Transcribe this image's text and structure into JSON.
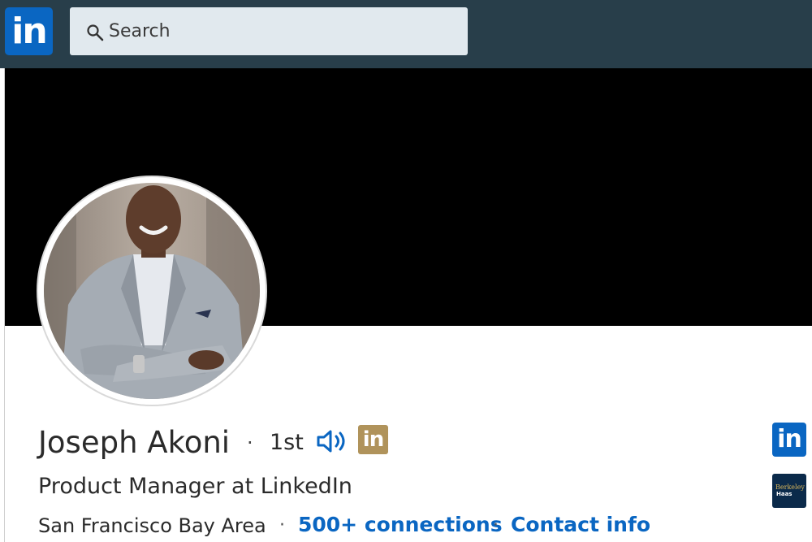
{
  "header": {
    "logo_text": "in",
    "search": {
      "placeholder": "Search"
    }
  },
  "profile": {
    "name": "Joseph Akoni",
    "degree": "1st",
    "premium_badge_text": "in",
    "headline": "Product Manager at LinkedIn",
    "location": "San Francisco Bay Area",
    "connections": "500+ connections",
    "contact": "Contact info",
    "separator": "·"
  },
  "sidebar_logos": {
    "company_logo_text": "in",
    "school_line1": "Berkeley",
    "school_line2": "Haas"
  },
  "icons": {
    "search": "search-icon",
    "speaker": "speaker-icon",
    "premium": "linkedin-premium-icon"
  },
  "colors": {
    "topbar": "#283e4a",
    "brand": "#0a66c2",
    "premium": "#b0935b",
    "link": "#0a66c2",
    "cover": "#000000"
  }
}
